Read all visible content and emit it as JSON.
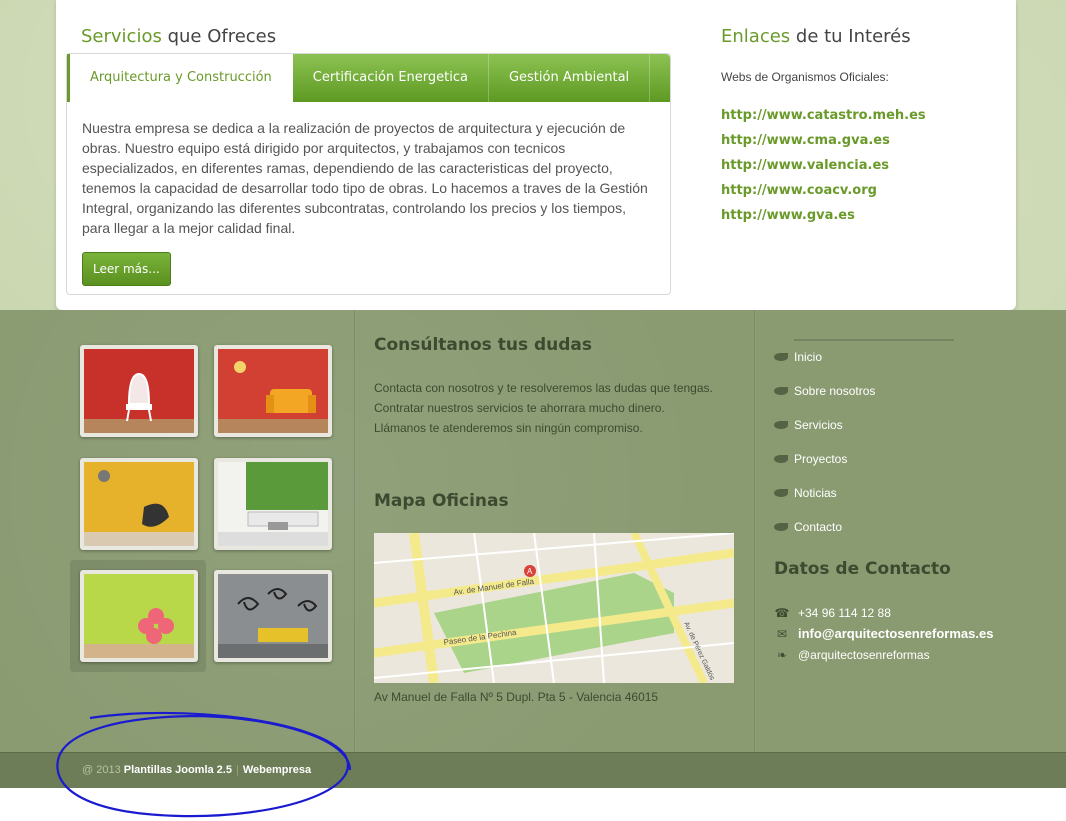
{
  "services": {
    "title_accent": "Servicios",
    "title_rest": " que Ofreces",
    "tabs": [
      {
        "label": "Arquitectura y Construcción"
      },
      {
        "label": "Certificación Energetica"
      },
      {
        "label": "Gestión Ambiental"
      }
    ],
    "body": "Nuestra empresa se dedica a la realización de proyectos de arquitectura y ejecución de obras. Nuestro equipo está dirigido por arquitectos, y trabajamos con tecnicos especializados, en diferentes ramas, dependiendo de las caracteristicas del proyecto, tenemos la capacidad de desarrollar todo tipo de obras. Lo hacemos a traves de la Gestión Integral, organizando las diferentes subcontratas, controlando los precios y los tiempos, para llegar a la mejor calidad final.",
    "read_more": "Leer más..."
  },
  "links": {
    "title_accent": "Enlaces",
    "title_rest": " de tu Interés",
    "subtitle": "Webs de Organismos Oficiales:",
    "items": [
      {
        "label": "http://www.catastro.meh.es"
      },
      {
        "label": "http://www.cma.gva.es"
      },
      {
        "label": "http://www.valencia.es"
      },
      {
        "label": "http://www.coacv.org"
      },
      {
        "label": "http://www.gva.es"
      }
    ]
  },
  "footer": {
    "dudas_title": "Consúltanos tus dudas",
    "dudas_lines": [
      "Contacta con nosotros y te resolveremos las dudas que tengas.",
      "Contratar nuestros servicios te ahorrara mucho dinero.",
      "Llámanos te atenderemos sin ningún compromiso."
    ],
    "mapa_title": "Mapa Oficinas",
    "map_labels": {
      "av_manuel_falla": "Av. de Manuel de Falla",
      "paseo_pechina": "Paseo de la Pechina",
      "av_perez_galdos": "Av. de Pérez Galdós",
      "marker": "A"
    },
    "map_address": "Av Manuel de Falla Nº 5 Dupl. Pta 5 - Valencia 46015",
    "nav": [
      {
        "label": "Inicio"
      },
      {
        "label": "Sobre nosotros"
      },
      {
        "label": "Servicios"
      },
      {
        "label": "Proyectos"
      },
      {
        "label": "Noticias"
      },
      {
        "label": "Contacto"
      }
    ],
    "contact_title": "Datos de Contacto",
    "contact": {
      "phone": "+34 96 114 12 88",
      "email": "info@arquitectosenreformas.es",
      "twitter": "@arquitectosenreformas"
    },
    "gallery_colors": [
      "#c8302a",
      "#d23f33",
      "#e6b22b",
      "#5a9a3a",
      "#b8d84a",
      "#8a8e90"
    ]
  },
  "copyright": {
    "prefix": "@ 2013",
    "link1": "Plantillas Joomla 2.5",
    "separator": "|",
    "link2": "Webempresa"
  },
  "colors": {
    "accent_green": "#6a9a2a",
    "footer_bg": "#8a9b72",
    "annotation_blue": "#1a1ad0"
  }
}
